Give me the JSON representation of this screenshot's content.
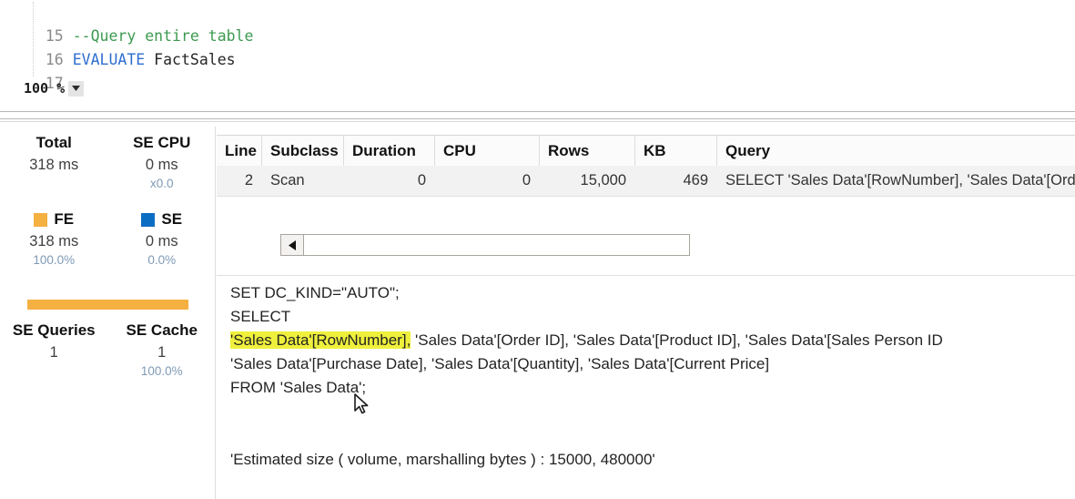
{
  "editor": {
    "zoom_label": "100 %",
    "zoom_caret_icon": "chevron-down-icon",
    "lines": [
      {
        "number": "15",
        "text": "--Query entire table",
        "token": "comment"
      },
      {
        "number": "16",
        "keyword": "EVALUATE",
        "rest": " FactSales",
        "token": "keyword"
      },
      {
        "number": "17",
        "text": "",
        "token": "plain"
      }
    ],
    "line_15_number": "15",
    "line_15_text": "--Query entire table",
    "line_16_number": "16",
    "line_16_keyword": "EVALUATE",
    "line_16_rest": " FactSales",
    "line_17_number": "17"
  },
  "metrics": {
    "total": {
      "label": "Total",
      "value": "318 ms"
    },
    "se_cpu": {
      "label": "SE CPU",
      "value": "0 ms",
      "multiplier": "x0.0"
    },
    "fe": {
      "label": "FE",
      "value": "318 ms",
      "percent": "100.0%",
      "color": "#f5b042"
    },
    "se": {
      "label": "SE",
      "value": "0 ms",
      "percent": "0.0%",
      "color": "#0a6dc2"
    },
    "bar": {
      "fe_percent_width": "100%",
      "color": "#f5b042"
    },
    "se_queries": {
      "label": "SE Queries",
      "value": "1"
    },
    "se_cache": {
      "label": "SE Cache",
      "value": "1",
      "percent": "100.0%"
    }
  },
  "grid": {
    "columns": [
      "Line",
      "Subclass",
      "Duration",
      "CPU",
      "Rows",
      "KB",
      "Query"
    ],
    "rows": [
      {
        "line": "2",
        "subclass": "Scan",
        "duration": "0",
        "cpu": "0",
        "rows": "15,000",
        "kb": "469",
        "query": "SELECT 'Sales Data'[RowNumber], 'Sales Data'[Order ID], 'Sales"
      }
    ]
  },
  "scrollbar": {
    "left_arrow_icon": "triangle-left-icon"
  },
  "sql": {
    "line1": "SET DC_KIND=\"AUTO\";",
    "line2": "SELECT",
    "line3_highlight": "'Sales Data'[RowNumber],",
    "line3_rest": " 'Sales Data'[Order ID], 'Sales Data'[Product ID], 'Sales Data'[Sales Person ID",
    "line4": "'Sales Data'[Purchase Date], 'Sales Data'[Quantity], 'Sales Data'[Current Price]",
    "line5": "FROM 'Sales Data';",
    "estimated": "'Estimated size ( volume, marshalling bytes ) : 15000, 480000'",
    "highlight_color": "#eff03c"
  },
  "cursor": {
    "icon": "mouse-pointer-icon"
  }
}
